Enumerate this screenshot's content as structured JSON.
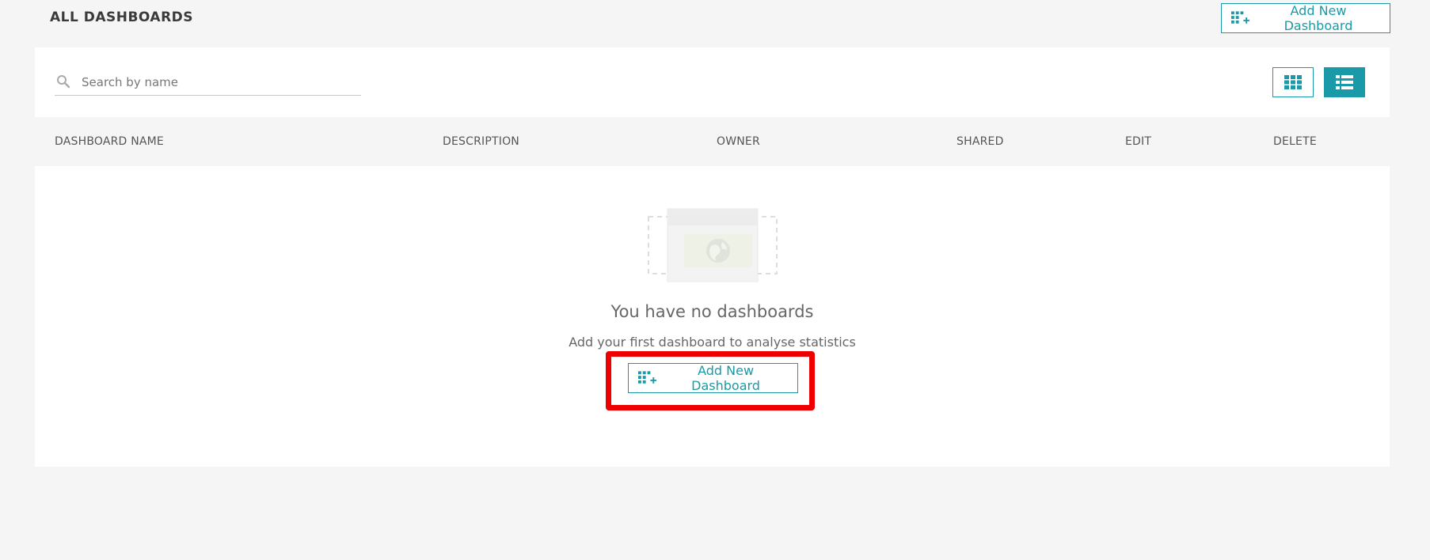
{
  "header": {
    "title": "ALL DASHBOARDS",
    "add_button_label": "Add New Dashboard"
  },
  "search": {
    "placeholder": "Search by name",
    "value": ""
  },
  "view_toggle": {
    "grid_icon": "grid-view-icon",
    "list_icon": "list-view-icon",
    "active": "list"
  },
  "table": {
    "columns": [
      "DASHBOARD NAME",
      "DESCRIPTION",
      "OWNER",
      "SHARED",
      "EDIT",
      "DELETE"
    ]
  },
  "empty_state": {
    "title": "You have no dashboards",
    "subtitle": "Add your first dashboard to analyse statistics",
    "button_label": "Add New Dashboard",
    "illustration_icon": "empty-dashboard-globe-icon"
  },
  "colors": {
    "accent": "#1a9aa8",
    "highlight": "#ee0000",
    "background": "#f5f5f5"
  }
}
